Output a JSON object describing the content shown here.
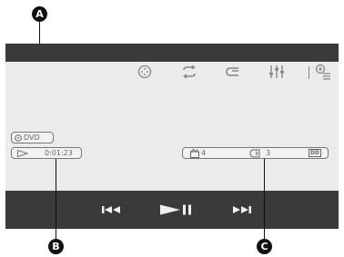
{
  "callouts": {
    "a": "A",
    "b": "B",
    "c": "C"
  },
  "top_icons": [
    "dvd-menu-icon",
    "repeat-icon",
    "return-icon",
    "audio-settings-icon",
    "zoom-icon"
  ],
  "source": {
    "label": "DVD",
    "icon": "disc-icon"
  },
  "playback": {
    "icon": "play-indicator-icon",
    "time": "0:01:23"
  },
  "disc_info": {
    "title_number": "4",
    "chapter_number": "3",
    "format": "DD"
  },
  "controls": [
    {
      "name": "previous-button",
      "icon": "skip-previous-icon"
    },
    {
      "name": "play-pause-button",
      "icon": "play-pause-icon"
    },
    {
      "name": "next-button",
      "icon": "skip-next-icon"
    }
  ],
  "colors": {
    "bar": "#3a3a3a",
    "screen": "#ebebeb",
    "icon": "#888888",
    "control": "#f0f0f0",
    "callout": "#111111"
  }
}
